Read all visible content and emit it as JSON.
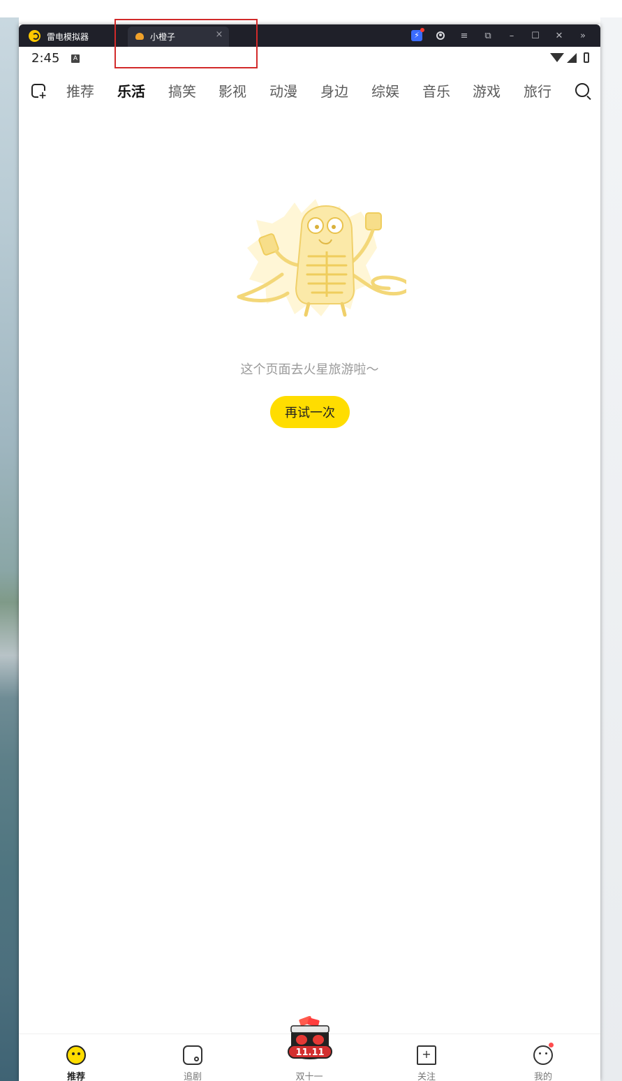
{
  "emulator": {
    "app_name": "雷电模拟器",
    "tab_label": "小橙子",
    "tab_close": "×",
    "controls": {
      "boost": "⚡",
      "menu": "≡",
      "sync": "⧉",
      "minimize": "–",
      "maximize": "☐",
      "close": "✕",
      "more": "»"
    }
  },
  "statusbar": {
    "time": "2:45",
    "a_badge": "A"
  },
  "categories": {
    "items": [
      "推荐",
      "乐活",
      "搞笑",
      "影视",
      "动漫",
      "身边",
      "综娱",
      "音乐",
      "游戏",
      "旅行"
    ],
    "active_index": 1
  },
  "error": {
    "message": "这个页面去火星旅游啦〜",
    "retry_label": "再试一次"
  },
  "bottom_nav": {
    "items": [
      {
        "label": "推荐",
        "icon": "smile-icon",
        "active": true
      },
      {
        "label": "追剧",
        "icon": "drama-icon",
        "active": false
      },
      {
        "label": "双十一",
        "icon": "double-eleven-icon",
        "active": false
      },
      {
        "label": "关注",
        "icon": "follow-icon",
        "active": false
      },
      {
        "label": "我的",
        "icon": "profile-icon",
        "active": false
      }
    ],
    "promo_text": "11.11"
  },
  "colors": {
    "accent": "#ffdd00",
    "highlight_box": "#d22a2a",
    "titlebar": "#1f2029"
  }
}
